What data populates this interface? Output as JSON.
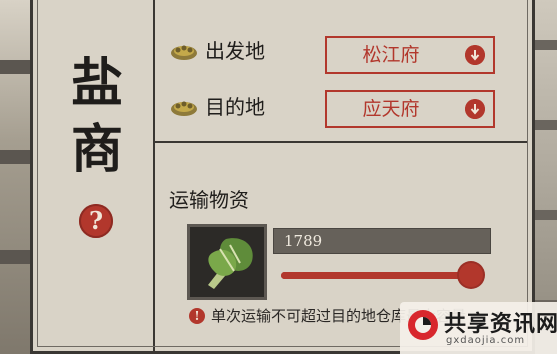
{
  "title_chars": [
    "盐",
    "商"
  ],
  "route": {
    "origin": {
      "label": "出发地",
      "value": "松江府",
      "icon": "boat-gold-icon"
    },
    "destination": {
      "label": "目的地",
      "value": "应天府",
      "icon": "boat-gold-icon"
    }
  },
  "cargo": {
    "section_title": "运输物资",
    "item_icon": "cabbage-icon",
    "quantity": "1789",
    "slider_fraction": 0.97
  },
  "notice": "单次运输不可超过目的地仓库最大容量",
  "help_label": "?",
  "colors": {
    "accent": "#b2372c",
    "paper": "#d9d3c7",
    "ink": "#1f1d1b"
  },
  "watermark": {
    "main": "共享资讯网",
    "sub": "gxdaojia.com"
  }
}
